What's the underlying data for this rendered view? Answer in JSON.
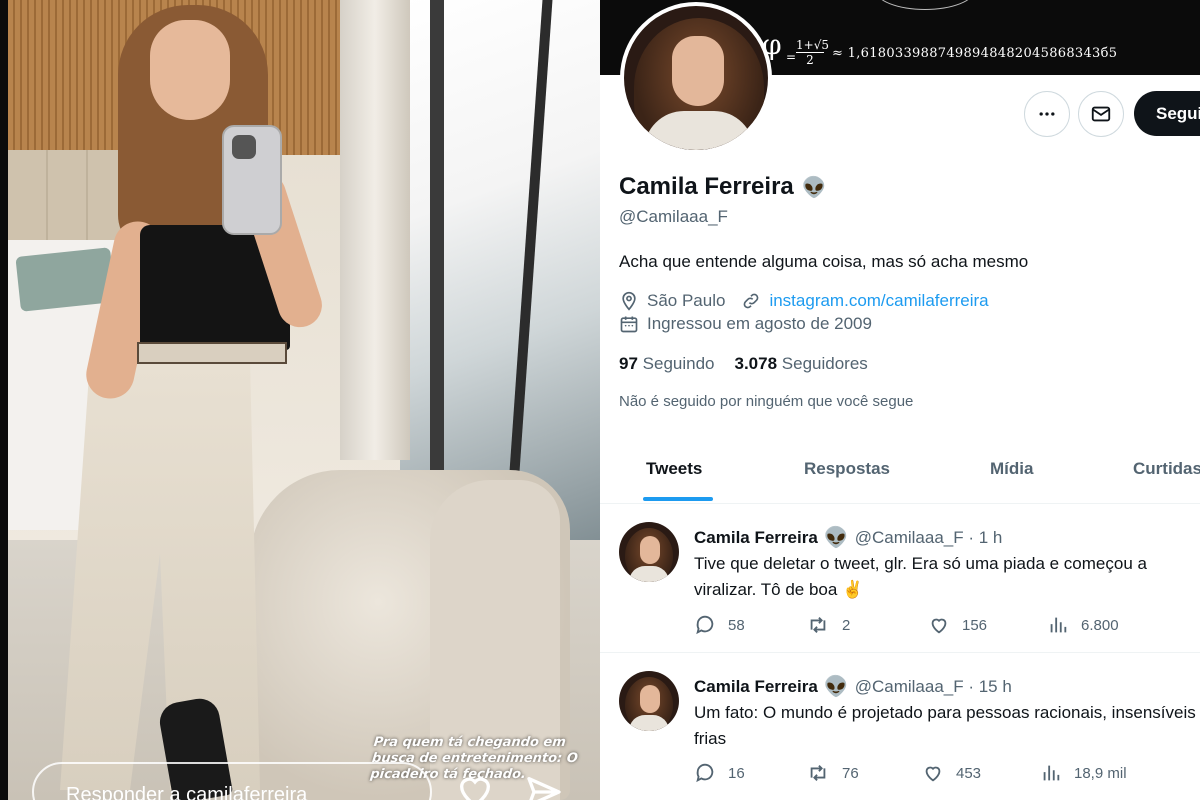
{
  "story": {
    "caption": "Pra quem tá chegando em busca de entretenimento: O picadeiro tá fechado.",
    "reply_placeholder": "Responder a camilaferreira"
  },
  "banner": {
    "phi": "φ",
    "numerator": "1+√5",
    "denominator": "2",
    "equals": "=",
    "value": "≈ 1,6180339887498948482045868343б5"
  },
  "profile": {
    "display_name": "Camila Ferreira",
    "badge_emoji": "👽",
    "handle": "@Camilaaa_F",
    "bio": "Acha que entende alguma coisa, mas só acha mesmo",
    "location": "São Paulo",
    "website": "instagram.com/camilaferreira",
    "joined": "Ingressou em agosto de 2009",
    "following_count": "97",
    "following_label": "Seguindo",
    "followers_count": "3.078",
    "followers_label": "Seguidores",
    "followed_note": "Não é seguido por ninguém que você segue",
    "follow_label": "Seguir"
  },
  "tabs": [
    {
      "label": "Tweets"
    },
    {
      "label": "Respostas"
    },
    {
      "label": "Mídia"
    },
    {
      "label": "Curtidas"
    }
  ],
  "tweets": [
    {
      "name": "Camila Ferreira",
      "emoji": "👽",
      "handle_time": "@Camilaaa_F · 1 h",
      "text": "Tive que deletar o tweet, glr. Era só uma piada e começou a viralizar. Tô de boa ✌️",
      "replies": "58",
      "retweets": "2",
      "likes": "156",
      "views": "6.800"
    },
    {
      "name": "Camila Ferreira",
      "emoji": "👽",
      "handle_time": "@Camilaaa_F · 15 h",
      "text": "Um fato: O mundo é projetado para pessoas racionais, insensíveis e frias",
      "replies": "16",
      "retweets": "76",
      "likes": "453",
      "views": "18,9 mil"
    }
  ],
  "colors": {
    "accent": "#1d9bf0",
    "text_primary": "#0f1419",
    "text_secondary": "#536471"
  }
}
